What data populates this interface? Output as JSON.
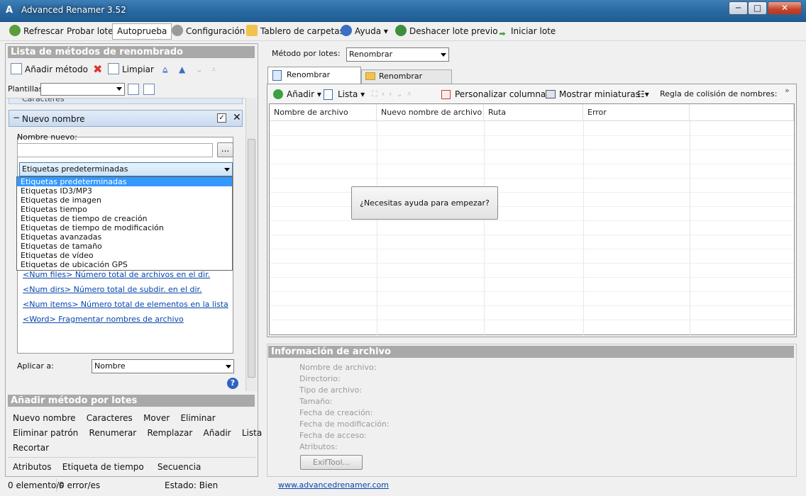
{
  "window": {
    "title": "Advanced Renamer 3.52",
    "minimize": "─",
    "maximize": "□",
    "close": "✕"
  },
  "toolbar": {
    "refresh": "Refrescar",
    "test_batch": "Probar lote",
    "autotest": "Autoprueba",
    "settings": "Configuración",
    "folder_board": "Tablero de carpetas",
    "help": "Ayuda",
    "undo_batch": "Deshacer lote previo",
    "start_batch": "Iniciar lote"
  },
  "left": {
    "method_list_title": "Lista de métodos de renombrado",
    "add_method": "Añadir método",
    "clear": "Limpiar",
    "templates_label": "Plantillas:",
    "templates_value": "",
    "prev_method_label": "Caracteres",
    "method": {
      "title": "Nuevo nombre",
      "new_name_label": "Nombre nuevo:",
      "new_name_value": "",
      "browse": "...",
      "tags_selected": "Etiquetas predeterminadas",
      "tag_options": [
        "Etiquetas predeterminadas",
        "Etiquetas ID3/MP3",
        "Etiquetas de imagen",
        "Etiquetas tiempo",
        "Etiquetas de tiempo de creación",
        "Etiquetas de tiempo de modificación",
        "Etiquetas avanzadas",
        "Etiquetas de tamaño",
        "Etiquetas de vídeo",
        "Etiquetas de ubicación GPS"
      ],
      "tag_links": [
        "<Num files> Número total de archivos en el dir.",
        "<Num dirs> Número total de subdir. en el dir.",
        "<Num items> Número total de elementos en la lista",
        "<Word> Fragmentar nombres de archivo"
      ],
      "apply_to_label": "Aplicar a:",
      "apply_to_value": "Nombre",
      "help_glyph": "?"
    },
    "batch": {
      "title": "Añadir método por lotes",
      "row1": [
        "Nuevo nombre",
        "Caracteres",
        "Mover",
        "Eliminar"
      ],
      "row2": [
        "Eliminar patrón",
        "Renumerar",
        "Remplazar",
        "Añadir",
        "Lista"
      ],
      "row3": [
        "Recortar"
      ],
      "row4": [
        "Atributos",
        "Etiqueta de tiempo",
        "Secuencia"
      ]
    }
  },
  "right": {
    "batch_mode_label": "Método por lotes:",
    "batch_mode_value": "Renombrar",
    "tabs": [
      "Renombrar archivos",
      "Renombrar carpetas"
    ],
    "tb": {
      "add": "Añadir",
      "list": "Lista",
      "custom_cols": "Personalizar columnas",
      "thumbnails": "Mostrar miniaturas",
      "collision": "Regla de colisión de nombres:",
      "more": "»"
    },
    "columns": [
      "Nombre de archivo",
      "Nuevo nombre de archivo",
      "Ruta",
      "Error"
    ],
    "help_button": "¿Necesitas ayuda para empezar?",
    "info": {
      "title": "Información de archivo",
      "fields": [
        "Nombre de archivo:",
        "Directorio:",
        "Tipo de archivo:",
        "Tamaño:",
        "Fecha de creación:",
        "Fecha de modificación:",
        "Fecha de acceso:",
        "Atributos:"
      ],
      "exif_button": "ExifTool..."
    }
  },
  "status": {
    "elements": "0 elemento/s",
    "errors": "0 error/es",
    "state": "Estado: Bien",
    "link": "www.advancedrenamer.com"
  },
  "icons": [
    "app-icon",
    "refresh-icon",
    "gear-icon",
    "folder-icon",
    "help-icon",
    "undo-icon",
    "play-icon",
    "add-method-icon",
    "delete-icon",
    "clear-icon",
    "move-top-icon",
    "move-up-icon",
    "move-down-icon",
    "move-bottom-icon",
    "template-save-icon",
    "template-load-icon",
    "collapse-icon",
    "checkbox-icon",
    "close-icon",
    "help-circle-icon",
    "file-tab-icon",
    "folder-tab-icon",
    "add-icon",
    "list-icon",
    "columns-icon",
    "thumbnails-icon",
    "view-icon"
  ],
  "colors": {
    "accent": "#3399ff",
    "header_gray": "#a9a9a9",
    "link": "#0645ad"
  }
}
